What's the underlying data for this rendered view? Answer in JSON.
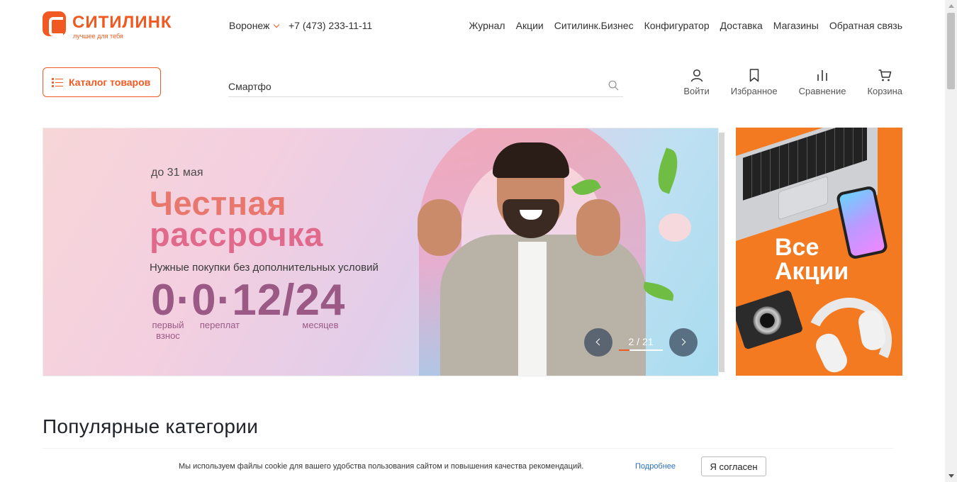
{
  "brand": {
    "name": "СИТИЛИНК",
    "tagline": "лучшее для тебя",
    "accent": "#f05a22"
  },
  "header": {
    "city": "Воронеж",
    "phone": "+7 (473) 233-11-11",
    "nav": [
      "Журнал",
      "Акции",
      "Ситилинк.Бизнес",
      "Конфигуратор",
      "Доставка",
      "Магазины",
      "Обратная связь"
    ]
  },
  "catalog_button": {
    "label": "Каталог товаров",
    "icon": "list-icon"
  },
  "search": {
    "value": "Смартфо",
    "icon": "search-icon"
  },
  "actions": [
    {
      "label": "Войти",
      "icon": "user-icon"
    },
    {
      "label": "Избранное",
      "icon": "bookmark-icon"
    },
    {
      "label": "Сравнение",
      "icon": "compare-icon"
    },
    {
      "label": "Корзина",
      "icon": "cart-icon"
    }
  ],
  "banner": {
    "date": "до 31 мая",
    "title_line1": "Честная",
    "title_line2": "рассрочка",
    "subtitle": "Нужные покупки без дополнительных условий",
    "numbers": "0·0·12/24",
    "label_first": "первый\nвзнос",
    "label_overpay": "переплат",
    "label_months": "месяцев",
    "slider": {
      "current": 2,
      "total": 21,
      "counter": "2 / 21"
    }
  },
  "promo": {
    "text_line1": "Все",
    "text_line2": "Акции",
    "color": "#f47a22"
  },
  "section": {
    "title": "Популярные категории"
  },
  "cookie": {
    "text": "Мы используем файлы cookie для вашего удобства пользования сайтом и повышения качества рекомендаций.",
    "link": "Подробнее",
    "button": "Я согласен"
  }
}
